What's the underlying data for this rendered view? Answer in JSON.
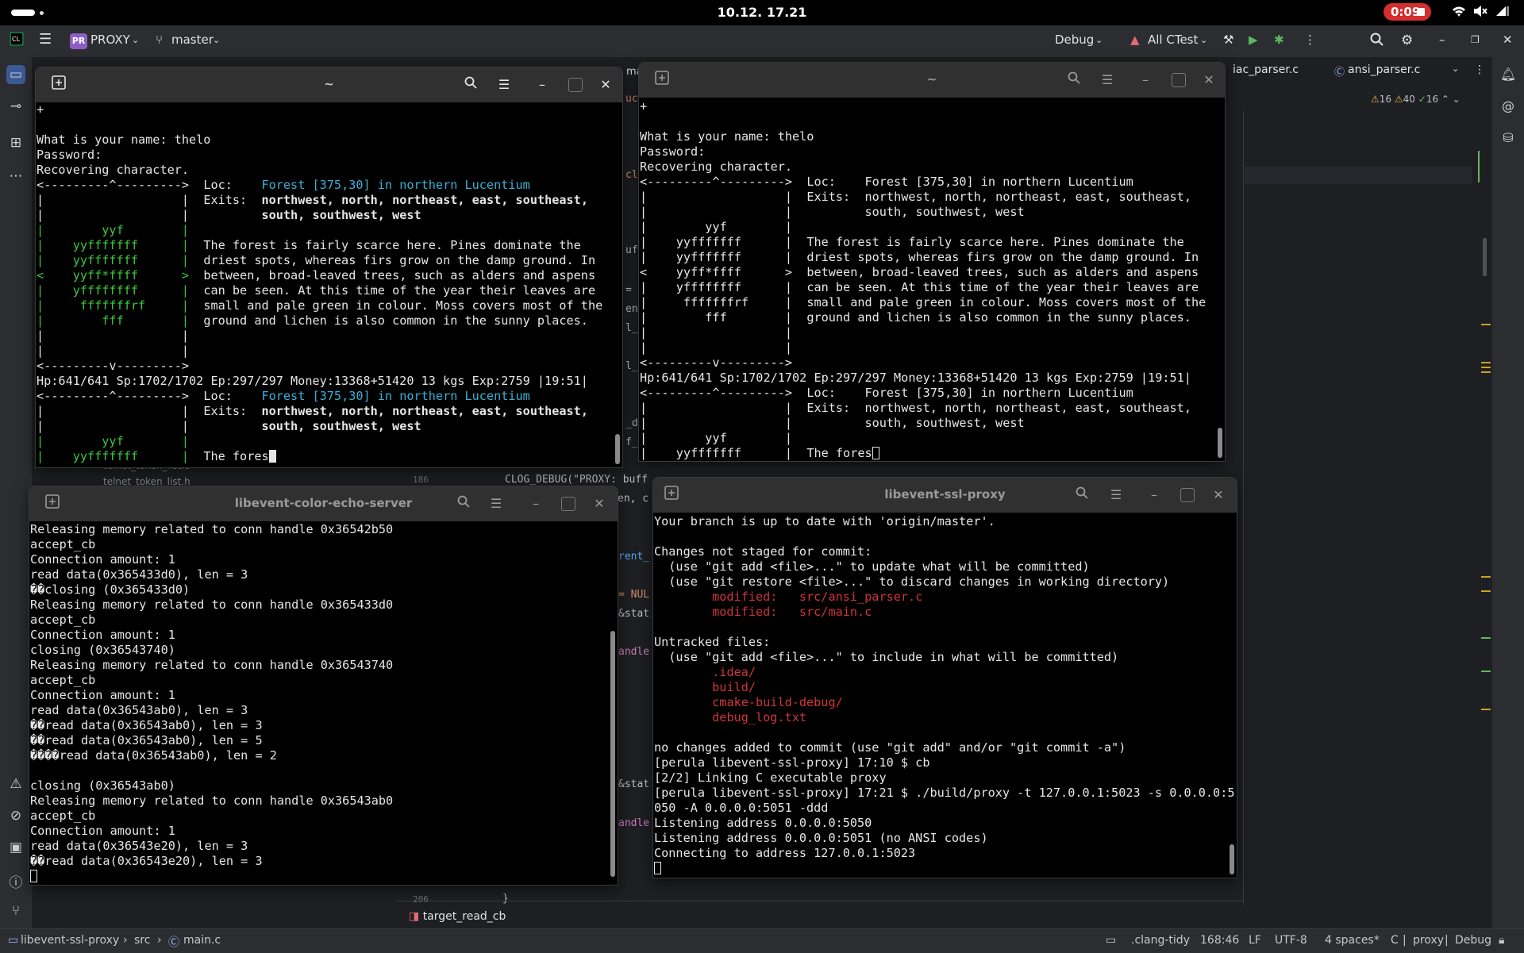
{
  "statusbar": {
    "clock": "10.12. 17.21",
    "record_time": "0:09"
  },
  "ide": {
    "project": "PROXY",
    "project_badge": "PR",
    "branch": "master",
    "run_config": "Debug",
    "target": "All CTest",
    "tabs": [
      "iac_parser.c",
      "ansi_parser.c"
    ],
    "tab_fragment": "ma",
    "inspections": {
      "warnings": "16",
      "weak": "40",
      "typos": "16"
    },
    "breadcrumb": {
      "project": "libevent-ssl-proxy",
      "folder": "src",
      "file": "main.c"
    },
    "function_crumb": "target_read_cb",
    "status": {
      "linter": ".clang-tidy",
      "position": "168:46",
      "line_sep": "LF",
      "encoding": "UTF-8",
      "indent": "4 spaces*",
      "lang": "C",
      "context": "proxy",
      "config": "Debug"
    },
    "editor_fragments": {
      "line_num_a": "186",
      "line_num_b": "206",
      "code_a": "CLOG_DEBUG(\"PROXY: buff",
      "code_b": "en, c",
      "code_c": "}",
      "tree_a": "telnet_token_list.c",
      "tree_b": "telnet_token_list.h",
      "left": [
        "uct",
        "cl",
        "uf",
        "= (",
        "en",
        "l_s",
        "l_s",
        "_d",
        "f_c",
        "rent_",
        "= NUL",
        "&stat",
        "andle",
        "&stat",
        "andle"
      ]
    }
  },
  "terminal1": {
    "title": "~",
    "scroll_top": "+",
    "prompt_lines": [
      "What is your name: thelo",
      "Password:",
      "Recovering character."
    ],
    "map_top": "<---------^--------->",
    "map_bottom": "<---------v--------->",
    "map_rows": [
      "|                   |",
      "|                   |",
      "|        yyf        |",
      "|    yyfffffff      |",
      "|    yyfffffff      |",
      "<    yyff*ffff      >",
      "|    yffffffff      |",
      "|     fffffffrf     |",
      "|        fff        |",
      "|                   |",
      "|                   |"
    ],
    "loc_label": "Loc:",
    "loc_value": "Forest [375,30] in northern Lucentium",
    "exits_label": "Exits:",
    "exits_1": "northwest, north, northeast, east, southeast,",
    "exits_2": "south, southwest, west",
    "desc": [
      "The forest is fairly scarce here. Pines dominate the",
      "driest spots, whereas firs grow on the damp ground. In",
      "between, broad-leaved trees, such as alders and aspens",
      "can be seen. At this time of the year their leaves are",
      "small and pale green in colour. Moss covers most of the",
      "ground and lichen is also common in the sunny places."
    ],
    "prompt_status": "Hp:641/641 Sp:1702/1702 Ep:297/297 Money:13368+51420 13 kgs Exp:2759 |19:51|",
    "typing": "The fores"
  },
  "terminal2": {
    "title": "~"
  },
  "terminal3": {
    "title": "libevent-color-echo-server",
    "lines": [
      "Releasing memory related to conn handle 0x36542b50",
      "accept_cb",
      "Connection amount: 1",
      "read data(0x365433d0), len = 3",
      "��closing (0x365433d0)",
      "Releasing memory related to conn handle 0x365433d0",
      "accept_cb",
      "Connection amount: 1",
      "closing (0x36543740)",
      "Releasing memory related to conn handle 0x36543740",
      "accept_cb",
      "Connection amount: 1",
      "read data(0x36543ab0), len = 3",
      "��read data(0x36543ab0), len = 3",
      "��read data(0x36543ab0), len = 5",
      "����read data(0x36543ab0), len = 2",
      "",
      "closing (0x36543ab0)",
      "Releasing memory related to conn handle 0x36543ab0",
      "accept_cb",
      "Connection amount: 1",
      "read data(0x36543e20), len = 3",
      "��read data(0x36543e20), len = 3"
    ]
  },
  "terminal4": {
    "title": "libevent-ssl-proxy",
    "lines_a": [
      "Your branch is up to date with 'origin/master'.",
      "",
      "Changes not staged for commit:",
      "  (use \"git add <file>...\" to update what will be committed)",
      "  (use \"git restore <file>...\" to discard changes in working directory)"
    ],
    "modified_label": "        modified:   ",
    "modified_files": [
      "src/ansi_parser.c",
      "src/main.c"
    ],
    "untracked_header": "Untracked files:",
    "untracked_hint": "  (use \"git add <file>...\" to include in what will be committed)",
    "untracked_files": [
      ".idea/",
      "build/",
      "cmake-build-debug/",
      "debug_log.txt"
    ],
    "lines_b": [
      "no changes added to commit (use \"git add\" and/or \"git commit -a\")",
      "[perula libevent-ssl-proxy] 17:10 $ cb",
      "[2/2] Linking C executable proxy",
      "[perula libevent-ssl-proxy] 17:21 $ ./build/proxy -t 127.0.0.1:5023 -s 0.0.0.0:5",
      "050 -A 0.0.0.0:5051 -ddd",
      "Listening address 0.0.0.0:5050",
      "Listening address 0.0.0.0:5051 (no ANSI codes)",
      "Connecting to address 127.0.0.1:5023"
    ]
  }
}
